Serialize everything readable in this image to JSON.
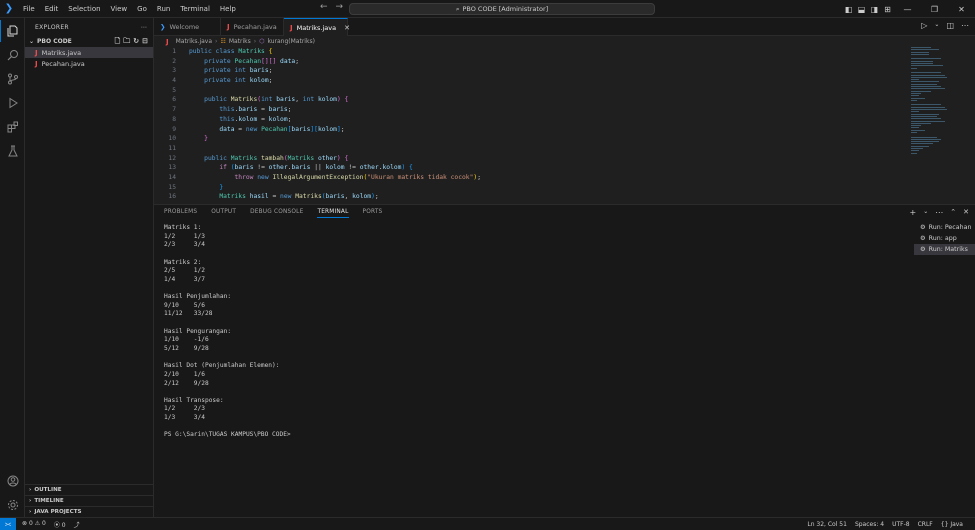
{
  "titlebar": {
    "menu": [
      "File",
      "Edit",
      "Selection",
      "View",
      "Go",
      "Run",
      "Terminal",
      "Help"
    ],
    "search_text": "PBO CODE [Administrator]"
  },
  "sidebar": {
    "header": "EXPLORER",
    "folder": "PBO CODE",
    "files": [
      "Matriks.java",
      "Pecahan.java"
    ],
    "sections": [
      "OUTLINE",
      "TIMELINE",
      "JAVA PROJECTS"
    ]
  },
  "tabs": [
    "Welcome",
    "Pecahan.java",
    "Matriks.java"
  ],
  "breadcrumb": [
    "Matriks.java",
    "Matriks",
    "kurang(Matriks)"
  ],
  "editor": {
    "line_numbers": [
      "1",
      "2",
      "3",
      "4",
      "5",
      "6",
      "7",
      "8",
      "9",
      "10",
      "11",
      "12",
      "13",
      "14",
      "15",
      "16"
    ]
  },
  "panel": {
    "tabs": [
      "PROBLEMS",
      "OUTPUT",
      "DEBUG CONSOLE",
      "TERMINAL",
      "PORTS"
    ],
    "active_tab": "TERMINAL",
    "terminal_lines": [
      "Matriks 1:",
      "1/2     1/3",
      "2/3     3/4",
      "",
      "Matriks 2:",
      "2/5     1/2",
      "1/4     3/7",
      "",
      "Hasil Penjumlahan:",
      "9/10    5/6",
      "11/12   33/28",
      "",
      "Hasil Pengurangan:",
      "1/10    -1/6",
      "5/12    9/28",
      "",
      "Hasil Dot (Penjumlahan Elemen):",
      "2/10    1/6",
      "2/12    9/28",
      "",
      "Hasil Transpose:",
      "1/2     2/3",
      "1/3     3/4",
      "",
      "PS G:\\Sarin\\TUGAS KAMPUS\\PBO CODE>"
    ],
    "runs": [
      "Run: Pecahan",
      "Run: app",
      "Run: Matriks"
    ]
  },
  "statusbar": {
    "errors": "0",
    "warnings": "0",
    "info": "0",
    "position": "Ln 32, Col 51",
    "spaces": "Spaces: 4",
    "encoding": "UTF-8",
    "eol": "CRLF",
    "language": "Java"
  }
}
